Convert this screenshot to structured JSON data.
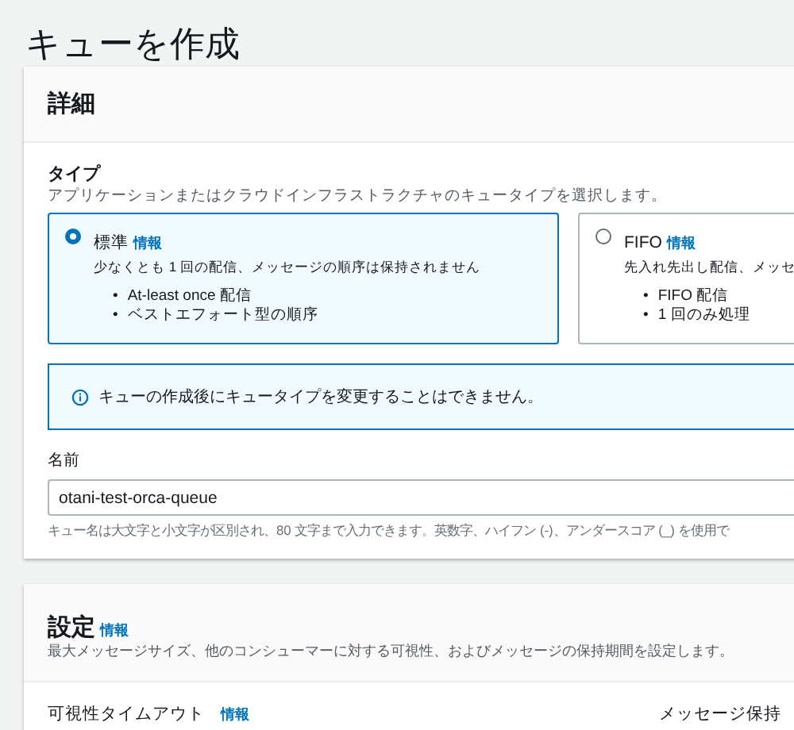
{
  "page_title": "キューを作成",
  "details": {
    "title": "詳細",
    "type_label": "タイプ",
    "type_description": "アプリケーションまたはクラウドインフラストラクチャのキュータイプを選択します。",
    "queue_types": [
      {
        "name": "標準",
        "info": "情報",
        "description": "少なくとも 1 回の配信、メッセージの順序は保持されません",
        "features": [
          {
            "marker": "•",
            "text": "At-least once 配信"
          },
          {
            "marker": "•",
            "text": "ベストエフォート型の順序"
          }
        ],
        "selected": true
      },
      {
        "name": "FIFO",
        "info": "情報",
        "description": "先入れ先出し配信、メッセ",
        "features": [
          {
            "marker": "•",
            "text": "FIFO 配信"
          },
          {
            "marker": "•",
            "text": "1 回のみ処理"
          }
        ],
        "selected": false
      }
    ],
    "alert": {
      "text": "キューの作成後にキュータイプを変更することはできません。"
    },
    "name_field": {
      "label": "名前",
      "value": "otani-test-orca-queue",
      "hint": "キュー名は大文字と小文字が区別され、80 文字まで入力できます。英数字、ハイフン (-)、アンダースコア (_) を使用で"
    }
  },
  "settings": {
    "title": "設定",
    "info": "情報",
    "description": "最大メッセージサイズ、他のコンシューマーに対する可視性、およびメッセージの保持期間を設定します。",
    "fields": [
      {
        "label": "可視性タイムアウト",
        "info": "情報"
      },
      {
        "label": "メッセージ保持"
      }
    ]
  }
}
